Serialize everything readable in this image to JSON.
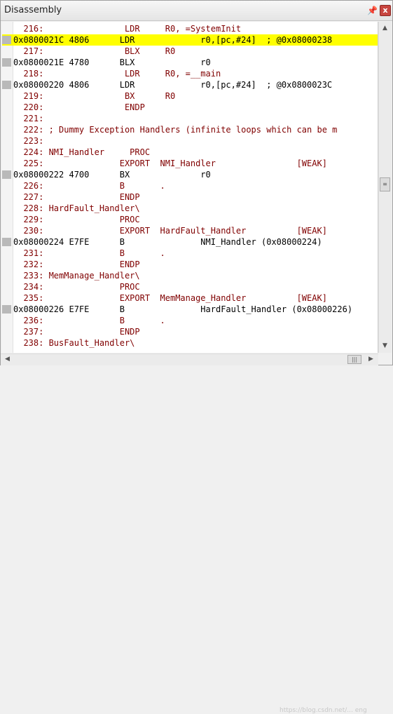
{
  "window": {
    "title": "Disassembly",
    "pin_icon": "pin-icon",
    "close_label": "x",
    "watermark": "https://blog.csdn.net/... eng"
  },
  "lines": [
    {
      "kind": "src",
      "text": "  216:                LDR     R0, =SystemInit",
      "marker": false,
      "highlight": false
    },
    {
      "kind": "asm",
      "text": "0x0800021C 4806      LDR             r0,[pc,#24]  ; @0x08000238",
      "marker": true,
      "highlight": true
    },
    {
      "kind": "src",
      "text": "  217:                BLX     R0",
      "marker": false,
      "highlight": false
    },
    {
      "kind": "asm",
      "text": "0x0800021E 4780      BLX             r0",
      "marker": true,
      "highlight": false
    },
    {
      "kind": "src",
      "text": "  218:                LDR     R0, =__main",
      "marker": false,
      "highlight": false
    },
    {
      "kind": "asm",
      "text": "0x08000220 4806      LDR             r0,[pc,#24]  ; @0x0800023C",
      "marker": true,
      "highlight": false
    },
    {
      "kind": "src",
      "text": "  219:                BX      R0",
      "marker": false,
      "highlight": false
    },
    {
      "kind": "src",
      "text": "  220:                ENDP",
      "marker": false,
      "highlight": false
    },
    {
      "kind": "src",
      "text": "  221:",
      "marker": false,
      "highlight": false
    },
    {
      "kind": "src",
      "text": "  222: ; Dummy Exception Handlers (infinite loops which can be m",
      "marker": false,
      "highlight": false
    },
    {
      "kind": "src",
      "text": "  223:",
      "marker": false,
      "highlight": false
    },
    {
      "kind": "src",
      "text": "  224: NMI_Handler     PROC",
      "marker": false,
      "highlight": false
    },
    {
      "kind": "src",
      "text": "  225:               EXPORT  NMI_Handler                [WEAK]",
      "marker": false,
      "highlight": false
    },
    {
      "kind": "asm",
      "text": "0x08000222 4700      BX              r0",
      "marker": true,
      "highlight": false
    },
    {
      "kind": "src",
      "text": "  226:               B       .",
      "marker": false,
      "highlight": false
    },
    {
      "kind": "src",
      "text": "  227:               ENDP",
      "marker": false,
      "highlight": false
    },
    {
      "kind": "src",
      "text": "  228: HardFault_Handler\\",
      "marker": false,
      "highlight": false
    },
    {
      "kind": "src",
      "text": "  229:               PROC",
      "marker": false,
      "highlight": false
    },
    {
      "kind": "src",
      "text": "  230:               EXPORT  HardFault_Handler          [WEAK]",
      "marker": false,
      "highlight": false
    },
    {
      "kind": "asm",
      "text": "0x08000224 E7FE      B               NMI_Handler (0x08000224)",
      "marker": true,
      "highlight": false
    },
    {
      "kind": "src",
      "text": "  231:               B       .",
      "marker": false,
      "highlight": false
    },
    {
      "kind": "src",
      "text": "  232:               ENDP",
      "marker": false,
      "highlight": false
    },
    {
      "kind": "src",
      "text": "  233: MemManage_Handler\\",
      "marker": false,
      "highlight": false
    },
    {
      "kind": "src",
      "text": "  234:               PROC",
      "marker": false,
      "highlight": false
    },
    {
      "kind": "src",
      "text": "  235:               EXPORT  MemManage_Handler          [WEAK]",
      "marker": false,
      "highlight": false
    },
    {
      "kind": "asm",
      "text": "0x08000226 E7FE      B               HardFault_Handler (0x08000226)",
      "marker": true,
      "highlight": false
    },
    {
      "kind": "src",
      "text": "  236:               B       .",
      "marker": false,
      "highlight": false
    },
    {
      "kind": "src",
      "text": "  237:               ENDP",
      "marker": false,
      "highlight": false
    },
    {
      "kind": "src",
      "text": "  238: BusFault_Handler\\",
      "marker": false,
      "highlight": false
    }
  ],
  "scroll": {
    "up_icon": "arrow-up-icon",
    "down_icon": "arrow-down-icon",
    "left_icon": "arrow-left-icon",
    "right_icon": "arrow-right-icon",
    "thumb_grip_icon": "grip-icon"
  },
  "colors": {
    "source_text": "#800000",
    "asm_text": "#000000",
    "highlight": "#ffff00",
    "marker": "#b9b9b9"
  }
}
